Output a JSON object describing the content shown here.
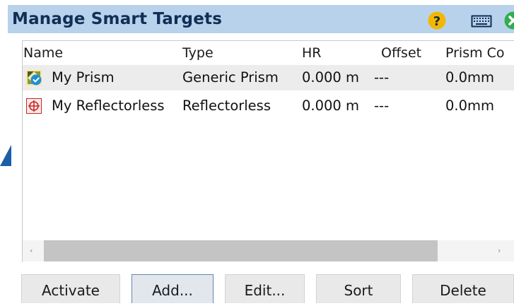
{
  "window": {
    "title": "Manage Smart Targets"
  },
  "icons": {
    "help": "help-icon",
    "keyboard": "keyboard-icon",
    "close": "close-icon"
  },
  "columns": [
    "Name",
    "Type",
    "HR",
    "Offset",
    "Prism Co"
  ],
  "rows": [
    {
      "name": "My Prism",
      "type": "Generic Prism",
      "hr": "0.000 m",
      "offset": "---",
      "prism_const": "0.0mm",
      "icon": "prism-active-icon",
      "selected": true
    },
    {
      "name": "My Reflectorless",
      "type": "Reflectorless",
      "hr": "0.000 m",
      "offset": "---",
      "prism_const": "0.0mm",
      "icon": "reflectorless-target-icon",
      "selected": false
    }
  ],
  "scrollbar": {
    "left_arrow": "‹",
    "right_arrow": "›"
  },
  "buttons": {
    "activate": "Activate",
    "add": "Add...",
    "edit": "Edit...",
    "sort": "Sort",
    "delete": "Delete"
  },
  "colors": {
    "titlebar": "#b9d2ec",
    "title_text": "#0f2f55",
    "help": "#f2b705",
    "close": "#2fae4f",
    "selected_row": "#ececec"
  }
}
